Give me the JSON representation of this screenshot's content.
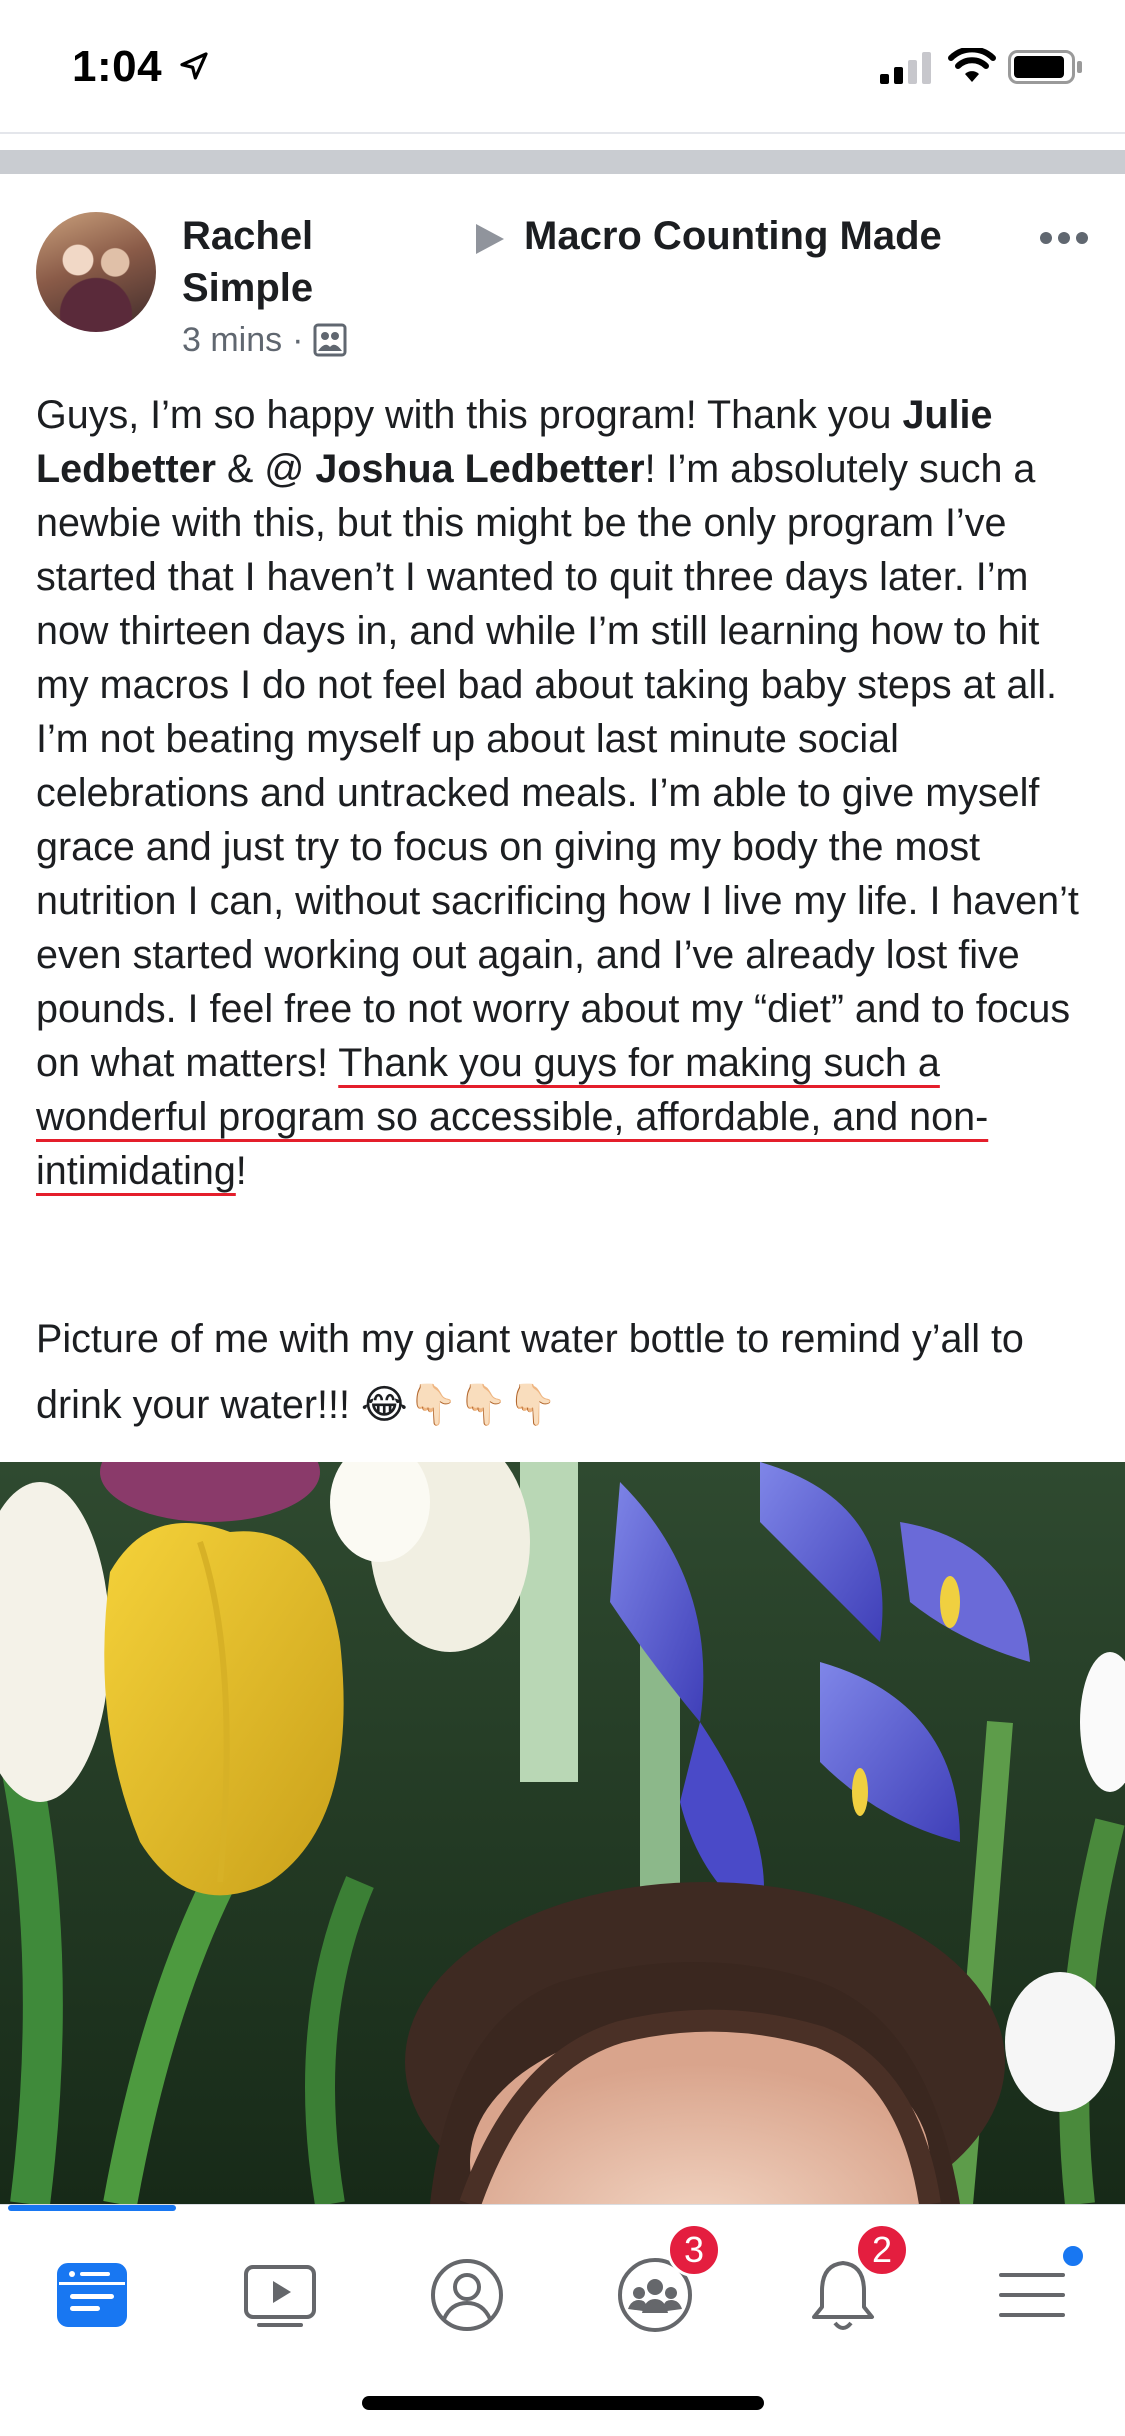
{
  "status_bar": {
    "time": "1:04"
  },
  "post": {
    "author": "Rachel",
    "group_name": "Macro Counting Made",
    "group_name_cont": "Simple",
    "timestamp": "3 mins",
    "separator": "·",
    "body": {
      "t1": "Guys, I’m so happy with this program! Thank you ",
      "mention1": "Julie Ledbetter",
      "t2": " & @ ",
      "mention2": "Joshua Ledbetter",
      "t3": "! I’m absolutely such a newbie with this, but this might be the only program I’ve started that I haven’t I wanted to quit three days later. I’m now thirteen days in, and while I’m still learning how to hit my macros I do not feel bad about taking baby steps at all. I’m not beating myself up about last minute social celebrations and untracked meals. I’m able to give myself grace and just try to focus on giving my body the most nutrition I can, without sacrificing how I live my life. I haven’t even started working out again, and I’ve already lost five pounds. I feel free to not worry about my “diet” and to focus on what matters! ",
      "underlined": "Thank you guys for making such a wonderful program so accessible, affordable, and non-intimidating",
      "t4": "!"
    },
    "body2": "Picture of me with my giant water bottle to remind y’all to drink your water!!! ",
    "emojis": "😂👇🏻👇🏻👇🏻"
  },
  "tab_bar": {
    "tabs": [
      {
        "icon": "news-feed-icon",
        "active": true
      },
      {
        "icon": "watch-video-icon",
        "active": false
      },
      {
        "icon": "profile-icon",
        "active": false
      },
      {
        "icon": "groups-icon",
        "active": false,
        "badge": "3"
      },
      {
        "icon": "notifications-bell-icon",
        "active": false,
        "badge": "2"
      },
      {
        "icon": "menu-icon",
        "active": false,
        "dot": true
      }
    ]
  },
  "colors": {
    "accent": "#1877f2",
    "badge_red": "#e41e3f",
    "underline_red": "#e41e2b",
    "meta_gray": "#606770"
  }
}
